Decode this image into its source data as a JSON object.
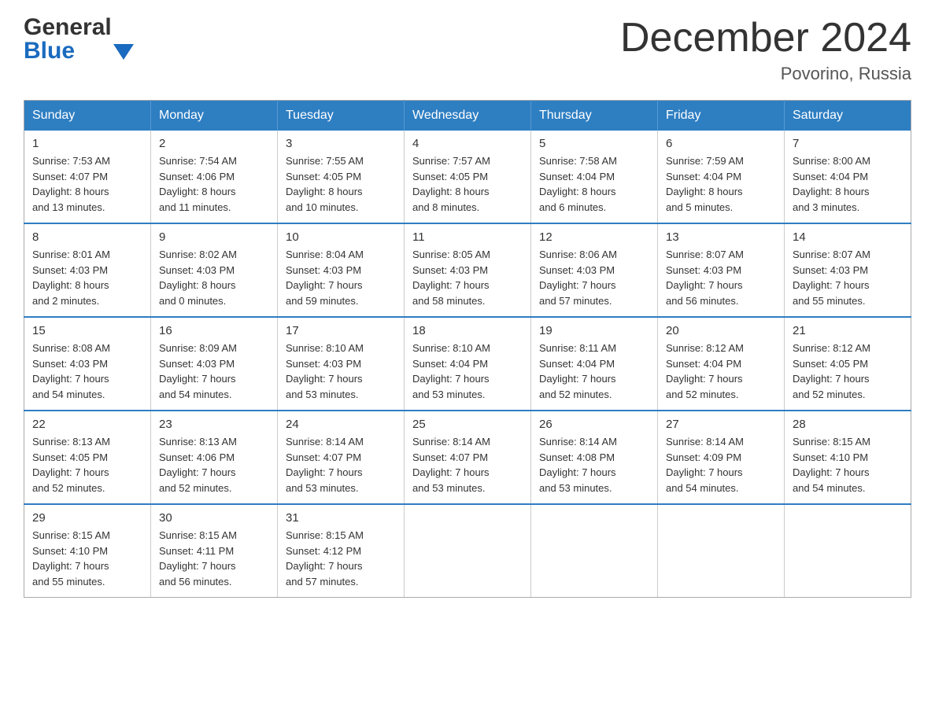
{
  "header": {
    "logo_general": "General",
    "logo_blue": "Blue",
    "title": "December 2024",
    "location": "Povoрino, Russia"
  },
  "calendar": {
    "days_of_week": [
      "Sunday",
      "Monday",
      "Tuesday",
      "Wednesday",
      "Thursday",
      "Friday",
      "Saturday"
    ],
    "weeks": [
      [
        {
          "day": "1",
          "info": "Sunrise: 7:53 AM\nSunset: 4:07 PM\nDaylight: 8 hours\nand 13 minutes."
        },
        {
          "day": "2",
          "info": "Sunrise: 7:54 AM\nSunset: 4:06 PM\nDaylight: 8 hours\nand 11 minutes."
        },
        {
          "day": "3",
          "info": "Sunrise: 7:55 AM\nSunset: 4:05 PM\nDaylight: 8 hours\nand 10 minutes."
        },
        {
          "day": "4",
          "info": "Sunrise: 7:57 AM\nSunset: 4:05 PM\nDaylight: 8 hours\nand 8 minutes."
        },
        {
          "day": "5",
          "info": "Sunrise: 7:58 AM\nSunset: 4:04 PM\nDaylight: 8 hours\nand 6 minutes."
        },
        {
          "day": "6",
          "info": "Sunrise: 7:59 AM\nSunset: 4:04 PM\nDaylight: 8 hours\nand 5 minutes."
        },
        {
          "day": "7",
          "info": "Sunrise: 8:00 AM\nSunset: 4:04 PM\nDaylight: 8 hours\nand 3 minutes."
        }
      ],
      [
        {
          "day": "8",
          "info": "Sunrise: 8:01 AM\nSunset: 4:03 PM\nDaylight: 8 hours\nand 2 minutes."
        },
        {
          "day": "9",
          "info": "Sunrise: 8:02 AM\nSunset: 4:03 PM\nDaylight: 8 hours\nand 0 minutes."
        },
        {
          "day": "10",
          "info": "Sunrise: 8:04 AM\nSunset: 4:03 PM\nDaylight: 7 hours\nand 59 minutes."
        },
        {
          "day": "11",
          "info": "Sunrise: 8:05 AM\nSunset: 4:03 PM\nDaylight: 7 hours\nand 58 minutes."
        },
        {
          "day": "12",
          "info": "Sunrise: 8:06 AM\nSunset: 4:03 PM\nDaylight: 7 hours\nand 57 minutes."
        },
        {
          "day": "13",
          "info": "Sunrise: 8:07 AM\nSunset: 4:03 PM\nDaylight: 7 hours\nand 56 minutes."
        },
        {
          "day": "14",
          "info": "Sunrise: 8:07 AM\nSunset: 4:03 PM\nDaylight: 7 hours\nand 55 minutes."
        }
      ],
      [
        {
          "day": "15",
          "info": "Sunrise: 8:08 AM\nSunset: 4:03 PM\nDaylight: 7 hours\nand 54 minutes."
        },
        {
          "day": "16",
          "info": "Sunrise: 8:09 AM\nSunset: 4:03 PM\nDaylight: 7 hours\nand 54 minutes."
        },
        {
          "day": "17",
          "info": "Sunrise: 8:10 AM\nSunset: 4:03 PM\nDaylight: 7 hours\nand 53 minutes."
        },
        {
          "day": "18",
          "info": "Sunrise: 8:10 AM\nSunset: 4:04 PM\nDaylight: 7 hours\nand 53 minutes."
        },
        {
          "day": "19",
          "info": "Sunrise: 8:11 AM\nSunset: 4:04 PM\nDaylight: 7 hours\nand 52 minutes."
        },
        {
          "day": "20",
          "info": "Sunrise: 8:12 AM\nSunset: 4:04 PM\nDaylight: 7 hours\nand 52 minutes."
        },
        {
          "day": "21",
          "info": "Sunrise: 8:12 AM\nSunset: 4:05 PM\nDaylight: 7 hours\nand 52 minutes."
        }
      ],
      [
        {
          "day": "22",
          "info": "Sunrise: 8:13 AM\nSunset: 4:05 PM\nDaylight: 7 hours\nand 52 minutes."
        },
        {
          "day": "23",
          "info": "Sunrise: 8:13 AM\nSunset: 4:06 PM\nDaylight: 7 hours\nand 52 minutes."
        },
        {
          "day": "24",
          "info": "Sunrise: 8:14 AM\nSunset: 4:07 PM\nDaylight: 7 hours\nand 53 minutes."
        },
        {
          "day": "25",
          "info": "Sunrise: 8:14 AM\nSunset: 4:07 PM\nDaylight: 7 hours\nand 53 minutes."
        },
        {
          "day": "26",
          "info": "Sunrise: 8:14 AM\nSunset: 4:08 PM\nDaylight: 7 hours\nand 53 minutes."
        },
        {
          "day": "27",
          "info": "Sunrise: 8:14 AM\nSunset: 4:09 PM\nDaylight: 7 hours\nand 54 minutes."
        },
        {
          "day": "28",
          "info": "Sunrise: 8:15 AM\nSunset: 4:10 PM\nDaylight: 7 hours\nand 54 minutes."
        }
      ],
      [
        {
          "day": "29",
          "info": "Sunrise: 8:15 AM\nSunset: 4:10 PM\nDaylight: 7 hours\nand 55 minutes."
        },
        {
          "day": "30",
          "info": "Sunrise: 8:15 AM\nSunset: 4:11 PM\nDaylight: 7 hours\nand 56 minutes."
        },
        {
          "day": "31",
          "info": "Sunrise: 8:15 AM\nSunset: 4:12 PM\nDaylight: 7 hours\nand 57 minutes."
        },
        {
          "day": "",
          "info": ""
        },
        {
          "day": "",
          "info": ""
        },
        {
          "day": "",
          "info": ""
        },
        {
          "day": "",
          "info": ""
        }
      ]
    ]
  }
}
